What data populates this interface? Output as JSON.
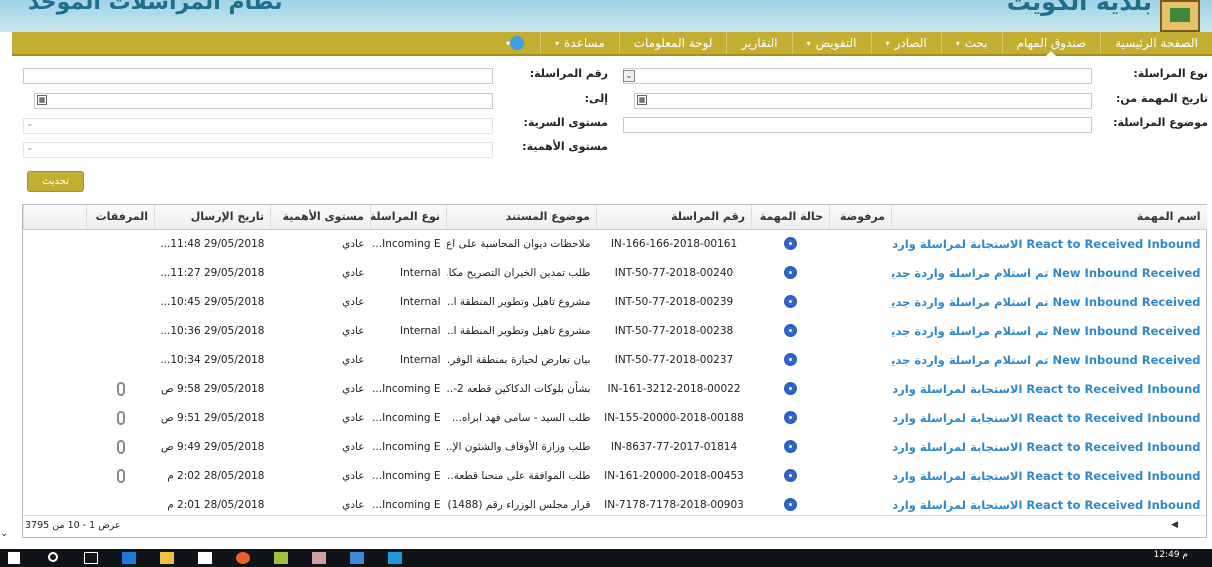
{
  "header": {
    "app_title": "نظام المراسلات الموحد",
    "org_name": "بلدية الكويت"
  },
  "nav": {
    "items": [
      {
        "label": "الصفحة الرئيسية",
        "dropdown": false,
        "active": false
      },
      {
        "label": "صندوق المهام",
        "dropdown": false,
        "active": true
      },
      {
        "label": "بحث",
        "dropdown": true,
        "active": false
      },
      {
        "label": "الصادر",
        "dropdown": true,
        "active": false
      },
      {
        "label": "التفويض",
        "dropdown": true,
        "active": false
      },
      {
        "label": "التقارير",
        "dropdown": false,
        "active": false
      },
      {
        "label": "لوحة المعلومات",
        "dropdown": false,
        "active": false
      },
      {
        "label": "مساعدة",
        "dropdown": true,
        "active": false
      }
    ],
    "caret": "▾"
  },
  "filters": {
    "type_label": "نوع المراسلة:",
    "number_label": "رقم المراسلة:",
    "date_from_label": "تاريخ المهمة من:",
    "date_to_label": "إلى:",
    "subject_label": "موضوع المراسلة:",
    "secrecy_label": "مستوى السرية:",
    "importance_label": "مستوى الأهمية:",
    "refresh_label": "تحديث"
  },
  "grid": {
    "columns": [
      "اسم المهمة",
      "مرفوضة",
      "حالة المهمة",
      "رقم المراسلة",
      "موضوع المستند",
      "نوع المراسلة",
      "مستوى الأهمية",
      "تاريخ الإرسال",
      "المرفقات"
    ],
    "rows": [
      {
        "name": "React to Received Inbound الاستجابة لمراسلة واردة",
        "number": "IN-166-166-2018-00161",
        "subject": "ملاحظات ديوان المحاسبة على اع...",
        "type": "Incoming E...",
        "importance": "عادي",
        "date": "29/05/2018 11:48...",
        "attach": false
      },
      {
        "name": "New Inbound Received تم استلام مراسلة واردة جديدة",
        "number": "INT-50-77-2018-00240",
        "subject": "طلب تمدين الخيران التصريح مكا...",
        "type": "Internal",
        "importance": "عادي",
        "date": "29/05/2018 11:27...",
        "attach": false
      },
      {
        "name": "New Inbound Received تم استلام مراسلة واردة جديدة",
        "number": "INT-50-77-2018-00239",
        "subject": "مشروع تاهيل وتطوير المنطقة ا...",
        "type": "Internal",
        "importance": "عادي",
        "date": "29/05/2018 10:45...",
        "attach": false
      },
      {
        "name": "New Inbound Received تم استلام مراسلة واردة جديدة",
        "number": "INT-50-77-2018-00238",
        "subject": "مشروع تاهيل وتطوير المنطقة ا...",
        "type": "Internal",
        "importance": "عادي",
        "date": "29/05/2018 10:36...",
        "attach": false
      },
      {
        "name": "New Inbound Received تم استلام مراسلة واردة جديدة",
        "number": "INT-50-77-2018-00237",
        "subject": "بيان تعارض لحيازة بمنطقة الوفر...",
        "type": "Internal",
        "importance": "عادي",
        "date": "29/05/2018 10:34...",
        "attach": false
      },
      {
        "name": "React to Received Inbound الاستجابة لمراسلة واردة",
        "number": "IN-161-3212-2018-00022",
        "subject": "بشأن بلوكات الدكاكين قطعه 2-...",
        "type": "Incoming E...",
        "importance": "عادي",
        "date": "29/05/2018 9:58 ص",
        "attach": true
      },
      {
        "name": "React to Received Inbound الاستجابة لمراسلة واردة",
        "number": "IN-155-20000-2018-00188",
        "subject": "طلب السيد - سامى فهد ابراه...",
        "type": "Incoming E...",
        "importance": "عادي",
        "date": "29/05/2018 9:51 ص",
        "attach": true
      },
      {
        "name": "React to Received Inbound الاستجابة لمراسلة واردة",
        "number": "IN-8637-77-2017-01814",
        "subject": "طلب وزارة الأوقاف والشئون الإ...",
        "type": "Incoming E...",
        "importance": "عادي",
        "date": "29/05/2018 9:49 ص",
        "attach": true
      },
      {
        "name": "React to Received Inbound الاستجابة لمراسلة واردة",
        "number": "IN-161-20000-2018-00453",
        "subject": "طلب الموافقة على منحنا قطعة...",
        "type": "Incoming E...",
        "importance": "عادي",
        "date": "28/05/2018 2:02 م",
        "attach": true
      },
      {
        "name": "React to Received Inbound الاستجابة لمراسلة واردة",
        "number": "IN-7178-7178-2018-00903",
        "subject": "قرار مجلس الوزراء رقم (1488) ا...",
        "type": "Incoming E...",
        "importance": "عادي",
        "date": "28/05/2018 2:01 م",
        "attach": false
      }
    ],
    "pageinfo": "عرض 1 - 10 من 3795"
  },
  "taskbar": {
    "clock": "12:49 م"
  },
  "colors": {
    "nav_bg": "#c4ae32",
    "link_blue": "#2f88c8",
    "status_blue": "#2a5fc8"
  }
}
